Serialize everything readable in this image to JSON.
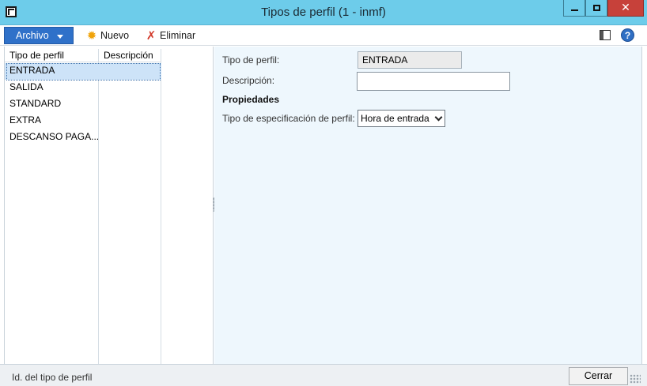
{
  "window": {
    "title": "Tipos de perfil (1 - inmf)",
    "close_glyph": "✕"
  },
  "toolbar": {
    "archivo_label": "Archivo",
    "nuevo_label": "Nuevo",
    "eliminar_label": "Eliminar",
    "help_glyph": "?"
  },
  "grid": {
    "columns": [
      "Tipo de perfil",
      "Descripción"
    ],
    "rows": [
      {
        "tipo": "ENTRADA",
        "descripcion": "",
        "selected": true
      },
      {
        "tipo": "SALIDA",
        "descripcion": ""
      },
      {
        "tipo": "STANDARD",
        "descripcion": ""
      },
      {
        "tipo": "EXTRA",
        "descripcion": ""
      },
      {
        "tipo": "DESCANSO PAGA...",
        "descripcion": ""
      }
    ]
  },
  "detail": {
    "tipo_label": "Tipo de perfil:",
    "tipo_value": "ENTRADA",
    "descripcion_label": "Descripción:",
    "descripcion_value": "",
    "propiedades_label": "Propiedades",
    "especificacion_label": "Tipo de especificación de perfil:",
    "especificacion_value": "Hora de entrada"
  },
  "status": {
    "text": "Id. del tipo de perfil",
    "cerrar_label": "Cerrar"
  },
  "colors": {
    "titlebar": "#6dccea",
    "archivo_button": "#2f71c9",
    "close_button": "#c7413a",
    "selected_row": "#cde3f8",
    "detail_background": "#eef7fd"
  },
  "icons": {
    "app": "app-icon",
    "nuevo": "sun-icon",
    "eliminar": "x-icon",
    "layout": "layout-icon",
    "help": "help-icon"
  }
}
